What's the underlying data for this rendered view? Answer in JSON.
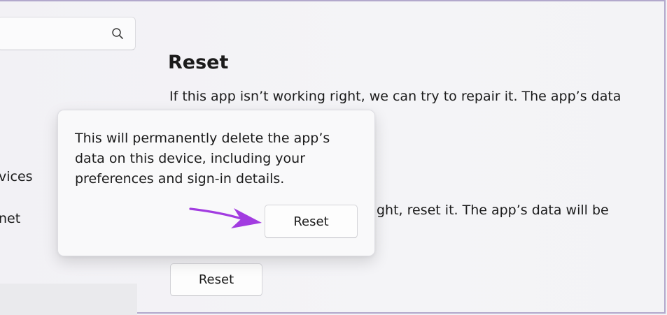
{
  "sidebar": {
    "search_icon": "search-icon",
    "items": [
      {
        "label": "vices"
      },
      {
        "label": "net"
      }
    ]
  },
  "main": {
    "section_title": "Reset",
    "repair_description_line1": "If this app isn’t working right, we can try to repair it. The app’s data",
    "reset_description_line1_visible": "ght, reset it. The app’s data will be",
    "reset_button_label": "Reset"
  },
  "flyout": {
    "message_lines": [
      "This will permanently delete the app’s",
      "data on this device, including your",
      "preferences and sign-in details."
    ],
    "confirm_button_label": "Reset"
  },
  "annotation": {
    "arrow_color": "#a23ce0",
    "arrow_icon": "arrow-right-icon"
  },
  "colors": {
    "background": "#f3f3f6",
    "flyout_background": "#f9f9fa",
    "border_accent": "#b2a8cc"
  }
}
